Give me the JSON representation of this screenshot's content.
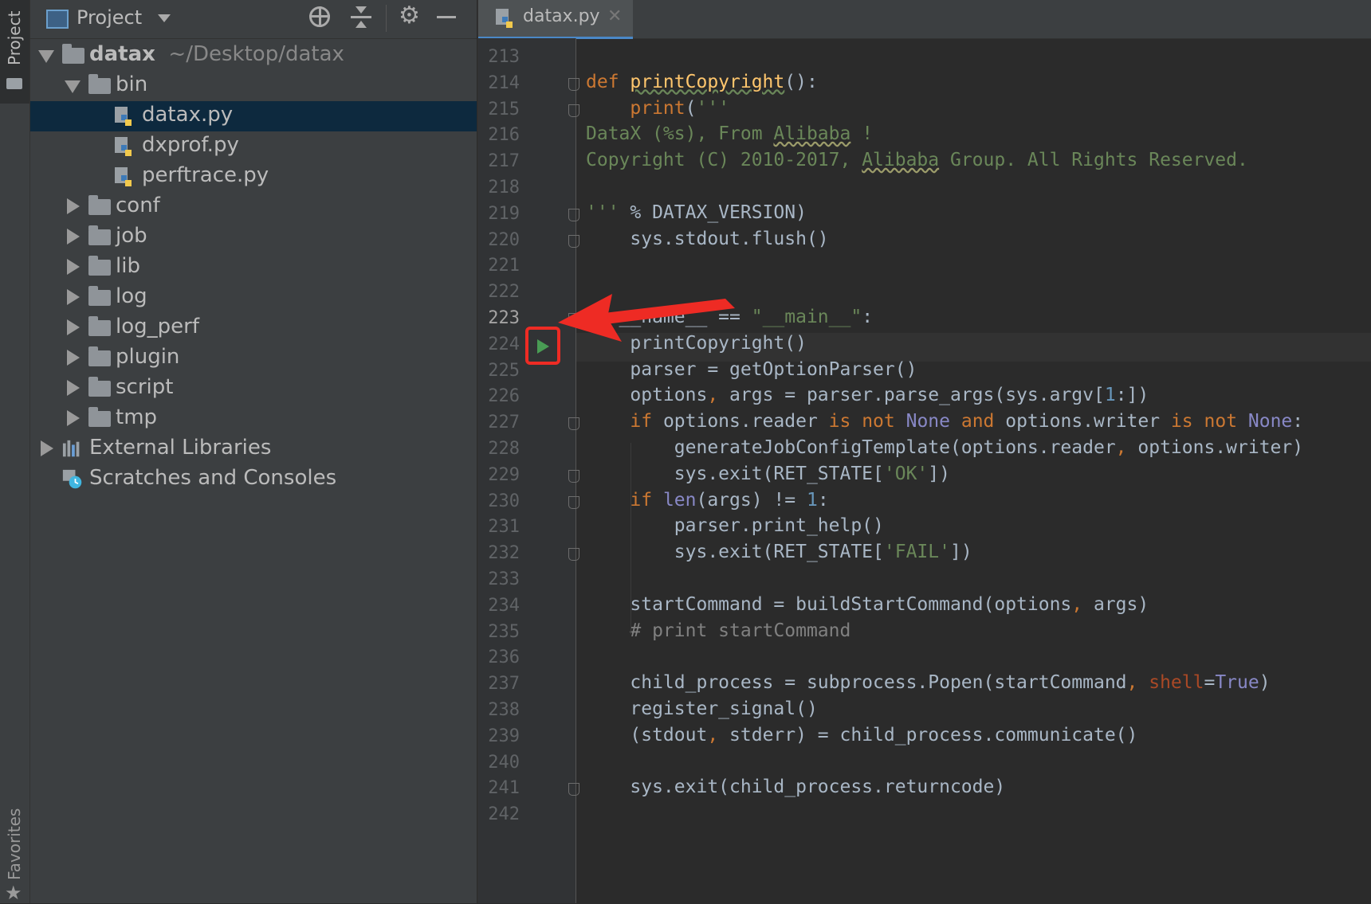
{
  "tool_strip": {
    "project_label": "Project",
    "favorites_label": "Favorites"
  },
  "panel": {
    "title": "Project",
    "tree": [
      {
        "label": "datax",
        "path": "~/Desktop/datax",
        "type": "folder",
        "state": "expanded",
        "level": 0
      },
      {
        "label": "bin",
        "type": "folder",
        "state": "expanded",
        "level": 1
      },
      {
        "label": "datax.py",
        "type": "python-file",
        "level": 2,
        "selected": true
      },
      {
        "label": "dxprof.py",
        "type": "python-file",
        "level": 2
      },
      {
        "label": "perftrace.py",
        "type": "python-file",
        "level": 2
      },
      {
        "label": "conf",
        "type": "folder",
        "state": "collapsed",
        "level": 1
      },
      {
        "label": "job",
        "type": "folder",
        "state": "collapsed",
        "level": 1
      },
      {
        "label": "lib",
        "type": "folder",
        "state": "collapsed",
        "level": 1
      },
      {
        "label": "log",
        "type": "folder",
        "state": "collapsed",
        "level": 1
      },
      {
        "label": "log_perf",
        "type": "folder",
        "state": "collapsed",
        "level": 1
      },
      {
        "label": "plugin",
        "type": "folder",
        "state": "collapsed",
        "level": 1
      },
      {
        "label": "script",
        "type": "folder",
        "state": "collapsed",
        "level": 1
      },
      {
        "label": "tmp",
        "type": "folder",
        "state": "collapsed",
        "level": 1
      },
      {
        "label": "External Libraries",
        "type": "library",
        "state": "collapsed",
        "level": 0
      },
      {
        "label": "Scratches and Consoles",
        "type": "scratches",
        "level": 0
      }
    ]
  },
  "editor": {
    "tab_label": "datax.py",
    "current_line": "223",
    "lines": [
      {
        "n": "213",
        "t": [
          [
            "",
            ""
          ]
        ]
      },
      {
        "n": "214",
        "t": [
          [
            "kw",
            "def "
          ],
          [
            "fn uw",
            "printCopyright"
          ],
          [
            "",
            "():"
          ]
        ]
      },
      {
        "n": "215",
        "t": [
          [
            "",
            "    "
          ],
          [
            "kw",
            "print"
          ],
          [
            "",
            "("
          ],
          [
            "str",
            "'''"
          ]
        ]
      },
      {
        "n": "216",
        "t": [
          [
            "str",
            "DataX (%s), From "
          ],
          [
            "str uwy",
            "Alibaba"
          ],
          [
            "str",
            " !"
          ]
        ]
      },
      {
        "n": "217",
        "t": [
          [
            "str",
            "Copyright (C) 2010-2017, "
          ],
          [
            "str uwy",
            "Alibaba"
          ],
          [
            "str",
            " Group. All Rights Reserved."
          ]
        ]
      },
      {
        "n": "218",
        "t": [
          [
            "",
            ""
          ]
        ]
      },
      {
        "n": "219",
        "t": [
          [
            "str",
            "'''"
          ],
          [
            "",
            " % DATAX_VERSION)"
          ]
        ]
      },
      {
        "n": "220",
        "t": [
          [
            "",
            "    sys.stdout.flush()"
          ]
        ]
      },
      {
        "n": "221",
        "t": [
          [
            "",
            ""
          ]
        ]
      },
      {
        "n": "222",
        "t": [
          [
            "",
            ""
          ]
        ]
      },
      {
        "n": "223",
        "t": [
          [
            "kw",
            "if "
          ],
          [
            "",
            "__name__ == "
          ],
          [
            "str",
            "\"__main__\""
          ],
          [
            "",
            ":"
          ]
        ]
      },
      {
        "n": "224",
        "t": [
          [
            "",
            "    printCopyright()"
          ]
        ]
      },
      {
        "n": "225",
        "t": [
          [
            "",
            "    parser = getOptionParser()"
          ]
        ]
      },
      {
        "n": "226",
        "t": [
          [
            "",
            "    options"
          ],
          [
            "kw",
            ", "
          ],
          [
            "",
            "args = parser.parse_args(sys.argv["
          ],
          [
            "num",
            "1"
          ],
          [
            "",
            ":])"
          ]
        ]
      },
      {
        "n": "227",
        "t": [
          [
            "",
            "    "
          ],
          [
            "kw",
            "if "
          ],
          [
            "",
            "options.reader "
          ],
          [
            "kw",
            "is not "
          ],
          [
            "bi",
            "None "
          ],
          [
            "kw",
            "and "
          ],
          [
            "",
            "options.writer "
          ],
          [
            "kw",
            "is not "
          ],
          [
            "bi",
            "None"
          ],
          [
            "",
            ":"
          ]
        ]
      },
      {
        "n": "228",
        "t": [
          [
            "",
            "        generateJobConfigTemplate(options.reader"
          ],
          [
            "kw",
            ", "
          ],
          [
            "",
            "options.writer)"
          ]
        ]
      },
      {
        "n": "229",
        "t": [
          [
            "",
            "        sys.exit(RET_STATE["
          ],
          [
            "str",
            "'OK'"
          ],
          [
            "",
            "])"
          ]
        ]
      },
      {
        "n": "230",
        "t": [
          [
            "",
            "    "
          ],
          [
            "kw",
            "if "
          ],
          [
            "bi",
            "len"
          ],
          [
            "",
            "(args) != "
          ],
          [
            "num",
            "1"
          ],
          [
            "",
            ":"
          ]
        ]
      },
      {
        "n": "231",
        "t": [
          [
            "",
            "        parser.print_help()"
          ]
        ]
      },
      {
        "n": "232",
        "t": [
          [
            "",
            "        sys.exit(RET_STATE["
          ],
          [
            "str",
            "'FAIL'"
          ],
          [
            "",
            "])"
          ]
        ]
      },
      {
        "n": "233",
        "t": [
          [
            "",
            ""
          ]
        ]
      },
      {
        "n": "234",
        "t": [
          [
            "",
            "    startCommand = buildStartCommand(options"
          ],
          [
            "kw",
            ", "
          ],
          [
            "",
            "args)"
          ]
        ]
      },
      {
        "n": "235",
        "t": [
          [
            "cm",
            "    # print startCommand"
          ]
        ]
      },
      {
        "n": "236",
        "t": [
          [
            "",
            ""
          ]
        ]
      },
      {
        "n": "237",
        "t": [
          [
            "",
            "    child_process = subprocess.Popen(startCommand"
          ],
          [
            "kw",
            ", "
          ],
          [
            "prm",
            "shell"
          ],
          [
            "",
            "="
          ],
          [
            "bi",
            "True"
          ],
          [
            "",
            ")"
          ]
        ]
      },
      {
        "n": "238",
        "t": [
          [
            "",
            "    register_signal()"
          ]
        ]
      },
      {
        "n": "239",
        "t": [
          [
            "",
            "    (stdout"
          ],
          [
            "kw",
            ", "
          ],
          [
            "",
            "stderr) = child_process.communicate()"
          ]
        ]
      },
      {
        "n": "240",
        "t": [
          [
            "",
            ""
          ]
        ]
      },
      {
        "n": "241",
        "t": [
          [
            "",
            "    sys.exit(child_process.returncode)"
          ]
        ]
      },
      {
        "n": "242",
        "t": [
          [
            "",
            ""
          ]
        ]
      }
    ],
    "fold_markers": [
      "214",
      "215",
      "219",
      "220",
      "223",
      "227",
      "229",
      "230",
      "232",
      "241"
    ]
  },
  "colors": {
    "accent": "#4a88c7",
    "annotation": "#ee2b24",
    "run_icon": "#499c54"
  }
}
